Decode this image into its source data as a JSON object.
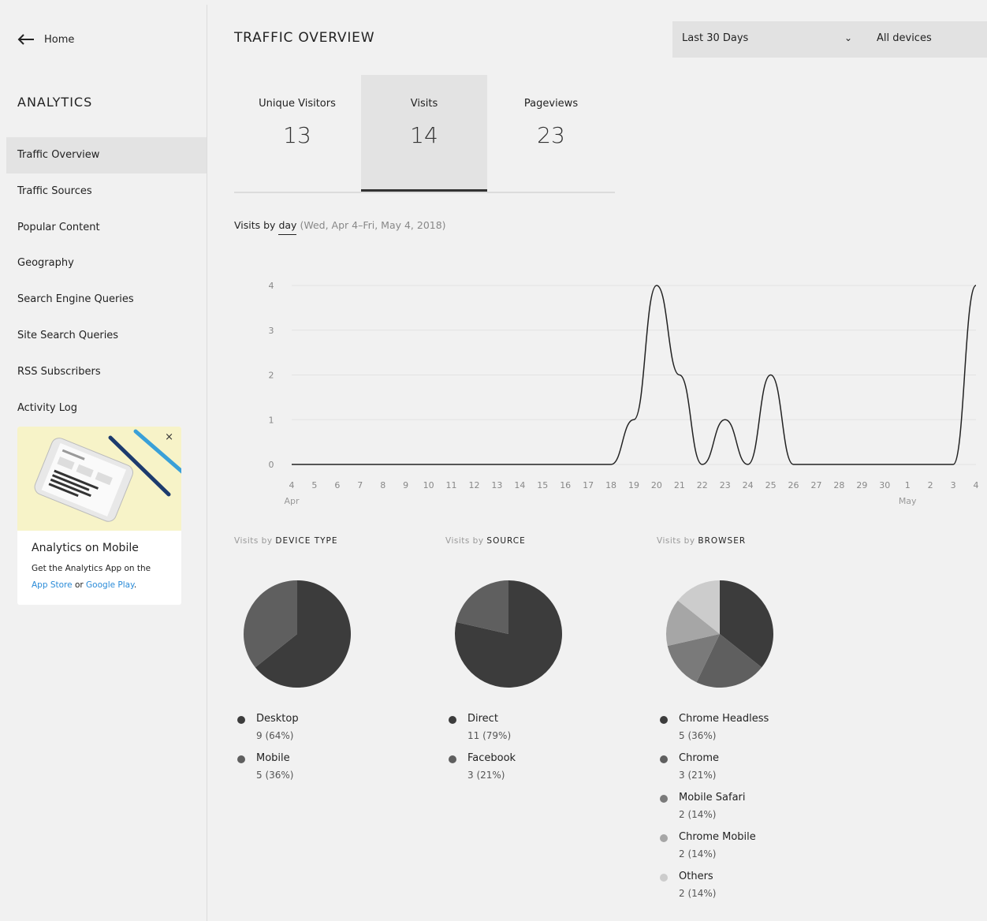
{
  "sidebar": {
    "back_label": "Home",
    "title": "ANALYTICS",
    "items": [
      {
        "label": "Traffic Overview",
        "active": true
      },
      {
        "label": "Traffic Sources"
      },
      {
        "label": "Popular Content"
      },
      {
        "label": "Geography"
      },
      {
        "label": "Search Engine Queries"
      },
      {
        "label": "Site Search Queries"
      },
      {
        "label": "RSS Subscribers"
      },
      {
        "label": "Activity Log"
      }
    ],
    "promo": {
      "close": "×",
      "title": "Analytics on Mobile",
      "text": "Get the Analytics App on the",
      "app_store": "App Store",
      "or": "or",
      "google_play": "Google Play",
      "period": "."
    }
  },
  "header": {
    "title": "TRAFFIC OVERVIEW",
    "range": "Last 30 Days",
    "device": "All devices"
  },
  "stats": [
    {
      "label": "Unique Visitors",
      "value": "13"
    },
    {
      "label": "Visits",
      "value": "14",
      "active": true
    },
    {
      "label": "Pageviews",
      "value": "23"
    }
  ],
  "chart_heading": {
    "prefix": "Visits by",
    "unit": "day",
    "range": "(Wed, Apr 4–Fri, May 4, 2018)"
  },
  "chart_data": [
    {
      "type": "line",
      "x": [
        "4",
        "5",
        "6",
        "7",
        "8",
        "9",
        "10",
        "11",
        "12",
        "13",
        "14",
        "15",
        "16",
        "17",
        "18",
        "19",
        "20",
        "21",
        "22",
        "23",
        "24",
        "25",
        "26",
        "27",
        "28",
        "29",
        "30",
        "1",
        "2",
        "3",
        "4"
      ],
      "month_labels": [
        {
          "index": 0,
          "label": "Apr"
        },
        {
          "index": 27,
          "label": "May"
        }
      ],
      "series": [
        {
          "values": [
            0,
            0,
            0,
            0,
            0,
            0,
            0,
            0,
            0,
            0,
            0,
            0,
            0,
            0,
            0,
            1,
            4,
            2,
            0,
            1,
            0,
            2,
            0,
            0,
            0,
            0,
            0,
            0,
            0,
            0,
            4
          ]
        }
      ],
      "ylim": [
        0,
        4
      ],
      "yticks": [
        0,
        1,
        2,
        3,
        4
      ],
      "grid": true,
      "color": "#222222"
    },
    {
      "type": "pie",
      "title_prefix": "Visits by",
      "title": "DEVICE TYPE",
      "slices": [
        {
          "label": "Desktop",
          "value": 9,
          "text": "9 (64%)",
          "color": "#3c3c3c"
        },
        {
          "label": "Mobile",
          "value": 5,
          "text": "5 (36%)",
          "color": "#5f5f5f"
        }
      ]
    },
    {
      "type": "pie",
      "title_prefix": "Visits by",
      "title": "SOURCE",
      "slices": [
        {
          "label": "Direct",
          "value": 11,
          "text": "11 (79%)",
          "color": "#3c3c3c"
        },
        {
          "label": "Facebook",
          "value": 3,
          "text": "3 (21%)",
          "color": "#5f5f5f"
        }
      ]
    },
    {
      "type": "pie",
      "title_prefix": "Visits by",
      "title": "BROWSER",
      "slices": [
        {
          "label": "Chrome Headless",
          "value": 5,
          "text": "5 (36%)",
          "color": "#3c3c3c"
        },
        {
          "label": "Chrome",
          "value": 3,
          "text": "3 (21%)",
          "color": "#5f5f5f"
        },
        {
          "label": "Mobile Safari",
          "value": 2,
          "text": "2 (14%)",
          "color": "#7a7a7a"
        },
        {
          "label": "Chrome Mobile",
          "value": 2,
          "text": "2 (14%)",
          "color": "#a6a6a6"
        },
        {
          "label": "Others",
          "value": 2,
          "text": "2 (14%)",
          "color": "#cccccc"
        }
      ]
    }
  ]
}
